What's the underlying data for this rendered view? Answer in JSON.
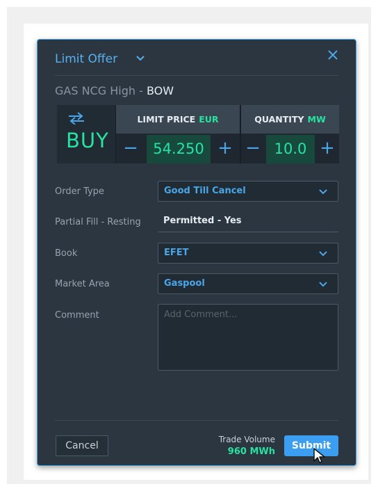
{
  "dialog": {
    "title": "Limit Offer",
    "instrument": {
      "name": "GAS NCG High",
      "separator": " - ",
      "code": "BOW"
    },
    "ticket": {
      "side_label": "BUY",
      "swap_icon": "swap-arrows-icon",
      "limit_price": {
        "label": "LIMIT PRICE",
        "unit": "EUR",
        "value": "54.250",
        "minus": "−",
        "plus": "+"
      },
      "quantity": {
        "label": "QUANTITY",
        "unit": "MW",
        "value": "10.0",
        "minus": "−",
        "plus": "+"
      }
    },
    "form": {
      "order_type": {
        "label": "Order Type",
        "value": "Good Till Cancel"
      },
      "partial_fill": {
        "label": "Partial Fill - Resting",
        "value": "Permitted - Yes"
      },
      "book": {
        "label": "Book",
        "value": "EFET"
      },
      "market_area": {
        "label": "Market Area",
        "value": "Gaspool"
      },
      "comment": {
        "label": "Comment",
        "placeholder": "Add Comment...",
        "value": ""
      }
    },
    "footer": {
      "cancel_label": "Cancel",
      "trade_volume_label": "Trade Volume",
      "trade_volume_value": "960 MWh",
      "submit_label": "Submit"
    }
  },
  "colors": {
    "dialog_bg": "#2b3640",
    "accent_blue": "#4aa6e8",
    "buy_green": "#27e3a2",
    "submit_blue": "#3c9ef0"
  },
  "icons": [
    "chevron-down-icon",
    "close-icon",
    "swap-arrows-icon",
    "mouse-pointer-icon"
  ]
}
